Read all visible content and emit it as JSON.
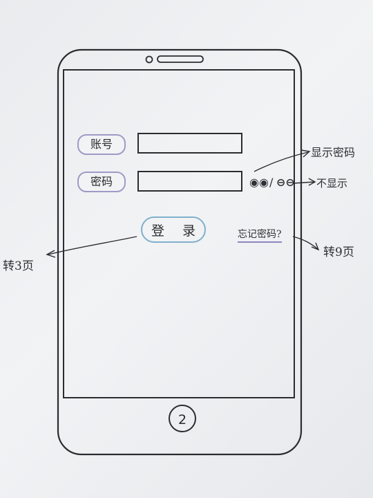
{
  "form": {
    "account_label": "账号",
    "password_label": "密码",
    "account_value": "",
    "password_value": "",
    "login_label": "登 录",
    "forgot_label": "忘记密码?"
  },
  "password_toggle": {
    "show_glyph": "◉◉",
    "separator": "/",
    "hide_glyph": "⊖⊖",
    "show_note": "显示密码",
    "hide_note": "不显示"
  },
  "annotations": {
    "login_target": "转3页",
    "forgot_target": "转9页"
  },
  "device": {
    "home_button_label": "2"
  }
}
